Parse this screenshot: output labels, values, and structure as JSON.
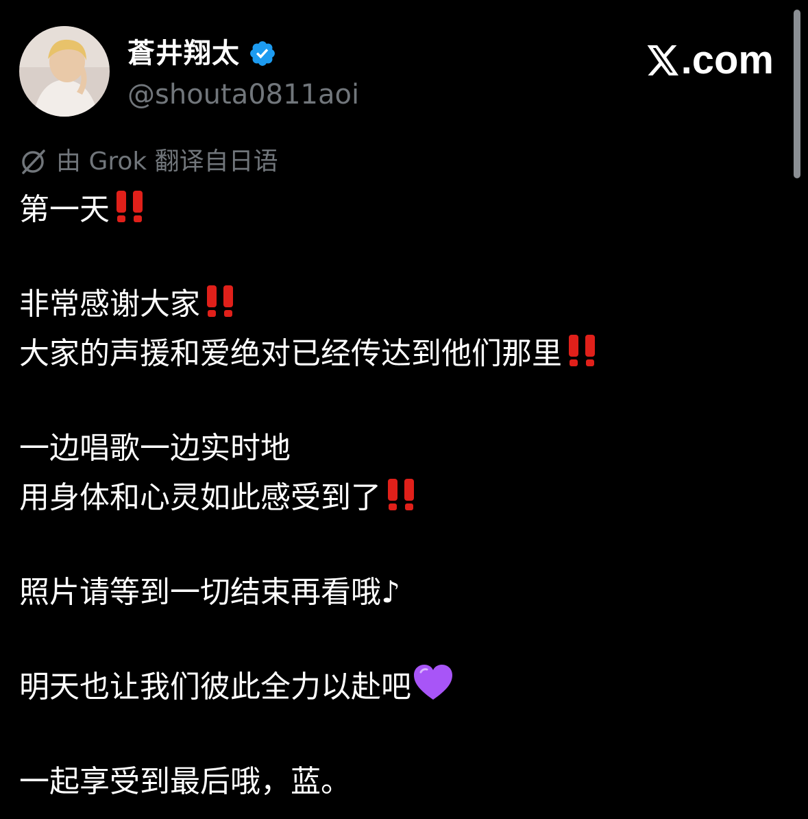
{
  "author": {
    "display_name": "蒼井翔太",
    "handle": "@shouta0811aoi",
    "verified_color": "#1d9bf0"
  },
  "brand": {
    "text": ".com"
  },
  "translation_note": "由 Grok 翻译自日语",
  "tweet_lines": [
    "第一天",
    "非常感谢大家",
    "大家的声援和爱绝对已经传达到他们那里",
    "一边唱歌一边实时地",
    "用身体和心灵如此感受到了",
    "照片请等到一切结束再看哦♪",
    "明天也让我们彼此全力以赴吧",
    "一起享受到最后哦，蓝。"
  ],
  "emoji": {
    "double_exclamation": "‼️",
    "purple_heart": "💜"
  },
  "colors": {
    "background": "#000000",
    "secondary_text": "#71767b",
    "exclamation_red": "#e0201a",
    "heart_purple": "#a855f7"
  }
}
